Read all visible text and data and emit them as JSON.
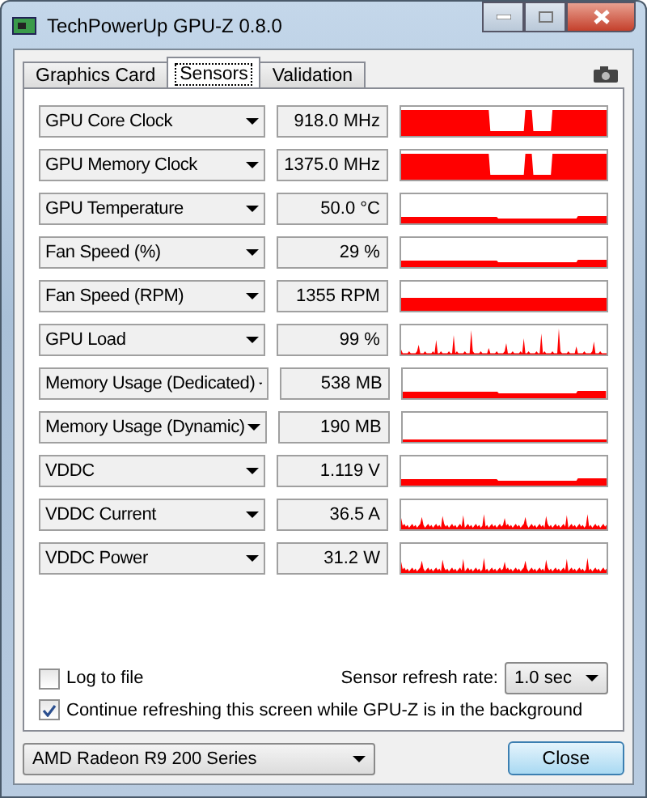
{
  "window": {
    "title": "TechPowerUp GPU-Z 0.8.0"
  },
  "tabs": [
    {
      "label": "Graphics Card",
      "selected": false
    },
    {
      "label": "Sensors",
      "selected": true
    },
    {
      "label": "Validation",
      "selected": false
    }
  ],
  "sensors": [
    {
      "name": "GPU Core Clock",
      "value": "918.0 MHz",
      "kind": "dips"
    },
    {
      "name": "GPU Memory Clock",
      "value": "1375.0 MHz",
      "kind": "dips"
    },
    {
      "name": "GPU Temperature",
      "value": "50.0 °C",
      "kind": "low"
    },
    {
      "name": "Fan Speed (%)",
      "value": "29 %",
      "kind": "low"
    },
    {
      "name": "Fan Speed (RPM)",
      "value": "1355 RPM",
      "kind": "flat"
    },
    {
      "name": "GPU Load",
      "value": "99 %",
      "kind": "spikes"
    },
    {
      "name": "Memory Usage (Dedicated)",
      "value": "538 MB",
      "kind": "low"
    },
    {
      "name": "Memory Usage (Dynamic)",
      "value": "190 MB",
      "kind": "line"
    },
    {
      "name": "VDDC",
      "value": "1.119 V",
      "kind": "low"
    },
    {
      "name": "VDDC Current",
      "value": "36.5 A",
      "kind": "noise"
    },
    {
      "name": "VDDC Power",
      "value": "31.2 W",
      "kind": "noise"
    }
  ],
  "log_to_file": {
    "label": "Log to file",
    "checked": false
  },
  "refresh_rate": {
    "label": "Sensor refresh rate:",
    "value": "1.0 sec"
  },
  "continue_refreshing": {
    "label": "Continue refreshing this screen while GPU-Z is in the background",
    "checked": true
  },
  "device": "AMD Radeon R9 200 Series",
  "close_button": "Close"
}
